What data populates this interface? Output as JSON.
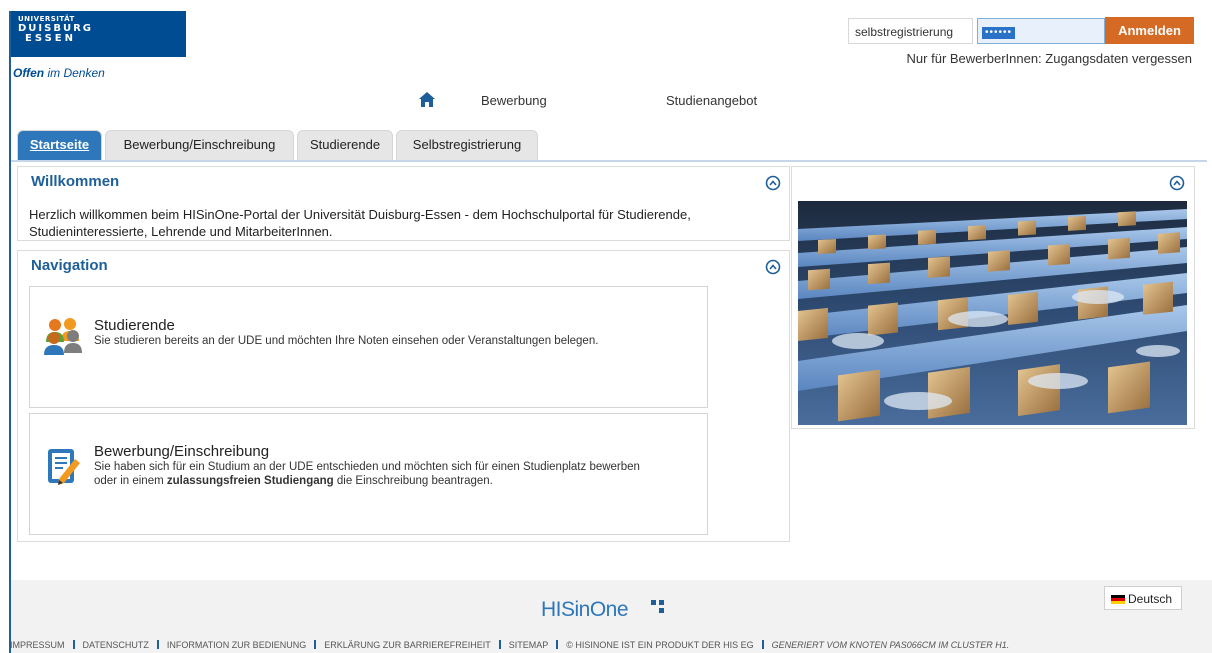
{
  "logo": {
    "line1": "UNIVERSITÄT",
    "line2": "DUISBURG",
    "line3": "ESSEN",
    "tagline_bold": "Offen",
    "tagline_rest": "im Denken"
  },
  "login": {
    "username_value": "selbstregistrierung",
    "password_mask": "••••••",
    "submit_label": "Anmelden",
    "forgot_text": "Nur für BewerberInnen: Zugangsdaten vergessen"
  },
  "topnav": {
    "items": [
      {
        "label": "Bewerbung"
      },
      {
        "label": "Studienangebot"
      }
    ]
  },
  "tabs": [
    {
      "label": "Startseite",
      "active": true
    },
    {
      "label": "Bewerbung/Einschreibung",
      "active": false
    },
    {
      "label": "Studierende",
      "active": false
    },
    {
      "label": "Selbstregistrierung",
      "active": false
    }
  ],
  "welcome": {
    "title": "Willkommen",
    "text": "Herzlich willkommen beim HISinOne-Portal der Universität Duisburg-Essen - dem Hochschulportal für Studierende, Studieninteressierte, Lehrende und MitarbeiterInnen."
  },
  "navigation": {
    "title": "Navigation",
    "cards": [
      {
        "title": "Studierende",
        "desc": "Sie studieren bereits an der UDE und möchten Ihre Noten einsehen oder Veranstaltungen belegen."
      },
      {
        "title": "Bewerbung/Einschreibung",
        "desc_part1": "Sie haben sich für ein Studium an der UDE entschieden und möchten sich für einen Studienplatz bewerben oder in einem",
        "desc_bold": "zulassungsfreien Studiengang",
        "desc_part2": "die Einschreibung beantragen."
      }
    ]
  },
  "footer": {
    "language": "Deutsch",
    "brand": "HISinOne",
    "links": [
      "IMPRESSUM",
      "DATENSCHUTZ",
      "INFORMATION ZUR BEDIENUNG",
      "ERKLÄRUNG ZUR BARRIEREFREIHEIT",
      "SITEMAP",
      "© HISINONE IST EIN PRODUKT DER HIS EG"
    ],
    "generated": "GENERIERT VOM KNOTEN PAS066CM IM CLUSTER H1."
  },
  "colors": {
    "brand_blue": "#004c93",
    "accent_blue": "#2e77ba",
    "login_orange": "#d46a24"
  }
}
